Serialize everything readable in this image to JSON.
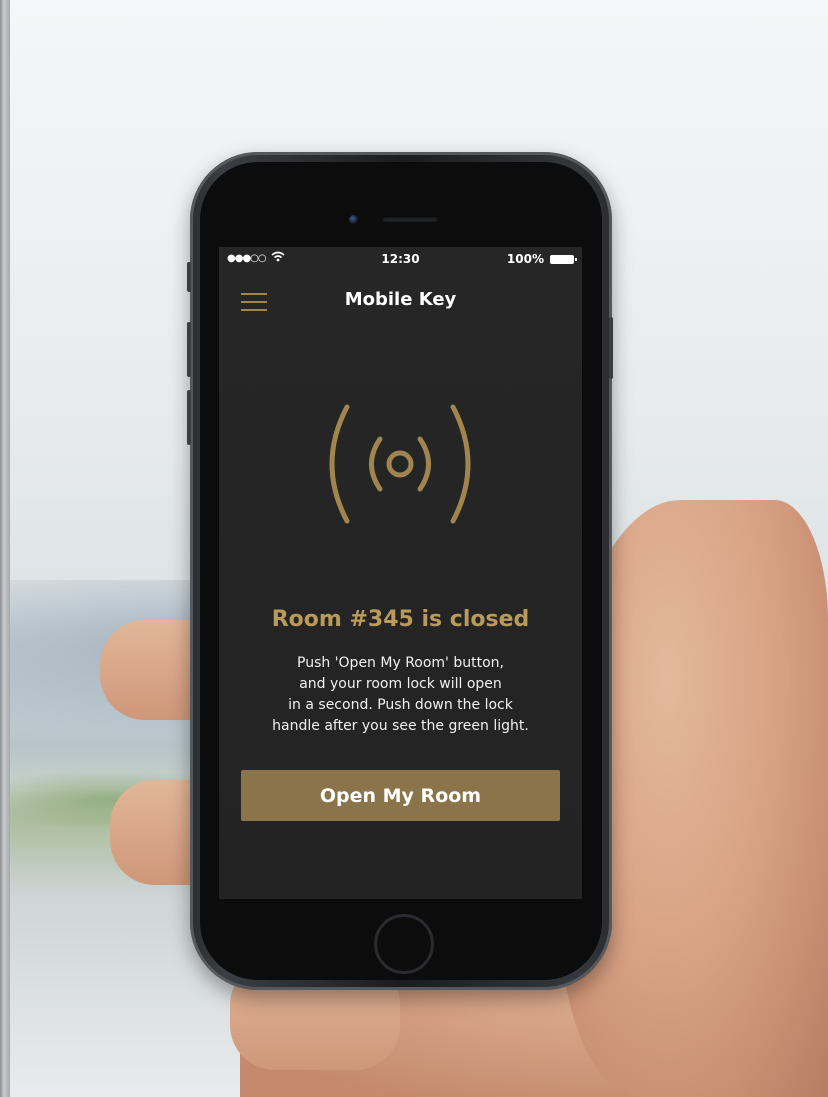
{
  "status_bar": {
    "signal_dots": "●●●○○",
    "time": "12:30",
    "battery": "100%"
  },
  "nav": {
    "title": "Mobile Key",
    "menu_icon": "hamburger-menu-icon"
  },
  "main": {
    "icon": "wireless-signal-icon",
    "room_status": "Room #345 is closed",
    "instructions": [
      "Push 'Open My Room' button,",
      "and your room lock will open",
      "in a second. Push down the lock",
      "handle after you see the green light."
    ],
    "button_label": "Open My Room"
  },
  "colors": {
    "accent": "#b99a5a",
    "button": "#8b744a",
    "screen_bg": "#252525"
  }
}
